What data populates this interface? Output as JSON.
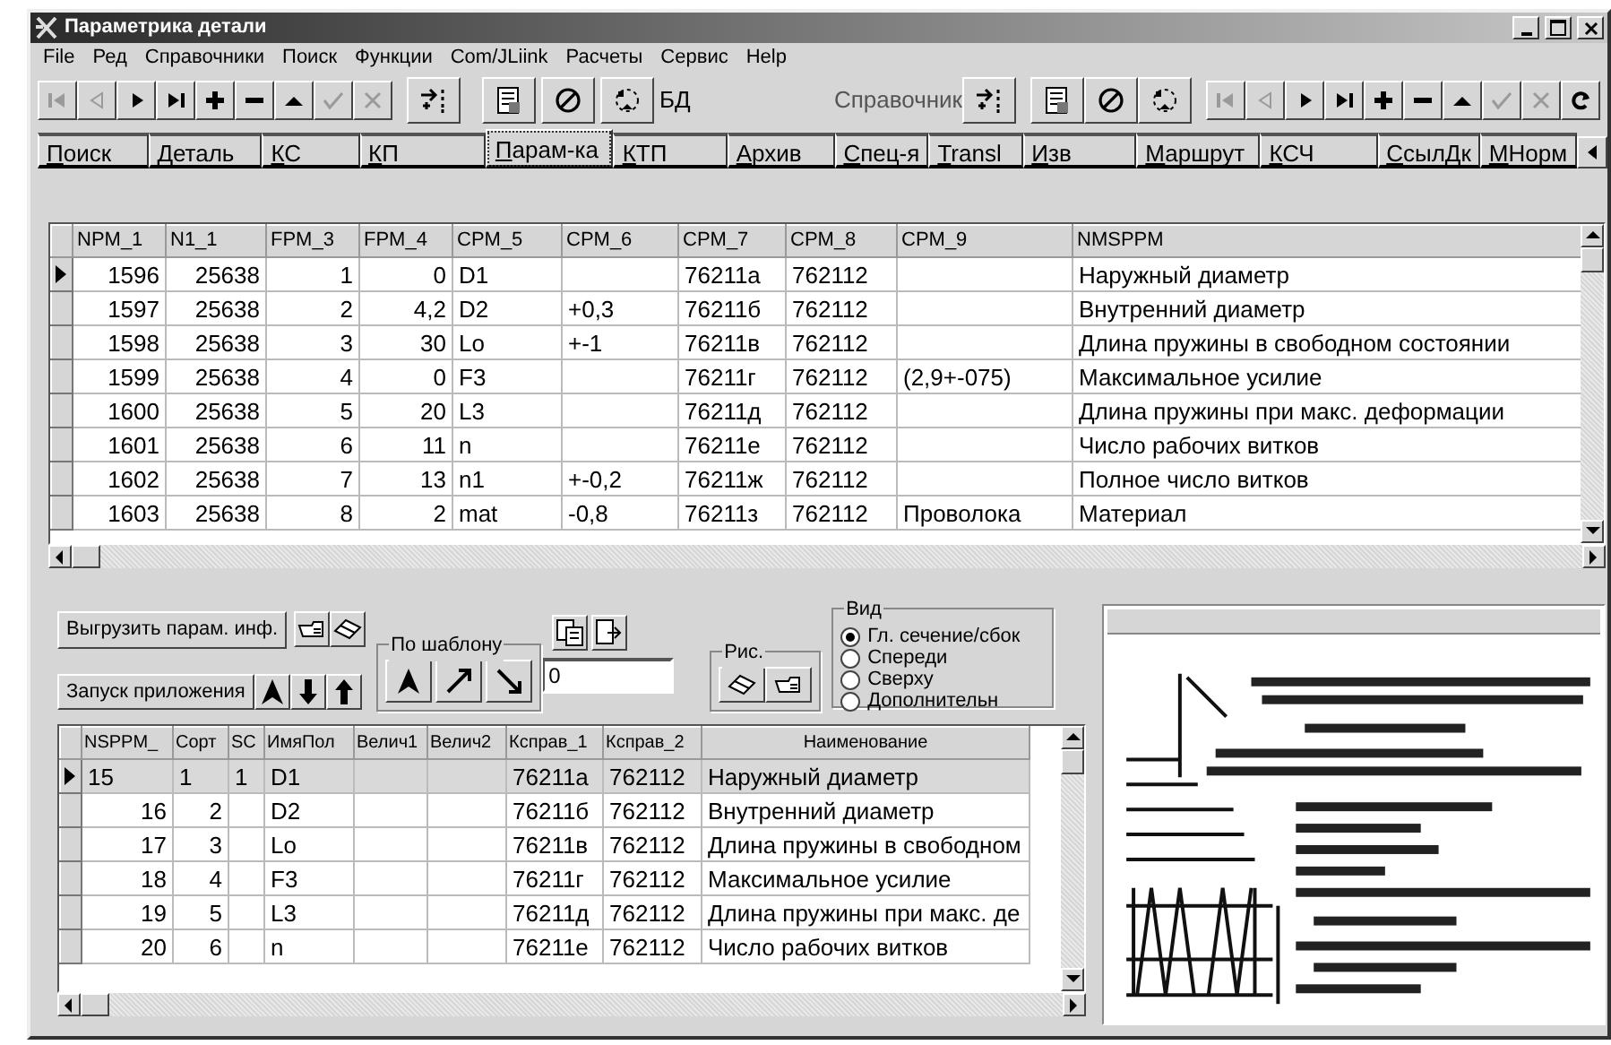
{
  "window": {
    "title": "Параметрика детали"
  },
  "menu": [
    "File",
    "Ред",
    "Справочники",
    "Поиск",
    "Функции",
    "Com/JLiink",
    "Расчеты",
    "Сервис",
    "Help"
  ],
  "toolbar": {
    "left_nav": [
      {
        "kind": "first",
        "disabled": true
      },
      {
        "kind": "prev",
        "disabled": true
      },
      {
        "kind": "next",
        "disabled": false
      },
      {
        "kind": "last",
        "disabled": false
      },
      {
        "kind": "add",
        "disabled": false
      },
      {
        "kind": "delete",
        "disabled": false
      },
      {
        "kind": "post",
        "disabled": false
      },
      {
        "kind": "apply",
        "disabled": true
      },
      {
        "kind": "cancel",
        "disabled": true
      }
    ],
    "db_label": "БД",
    "ref_label": "Справочник",
    "right_nav": [
      {
        "kind": "first",
        "disabled": true
      },
      {
        "kind": "prev",
        "disabled": true
      },
      {
        "kind": "next",
        "disabled": false
      },
      {
        "kind": "last",
        "disabled": false
      },
      {
        "kind": "add",
        "disabled": false
      },
      {
        "kind": "delete",
        "disabled": false
      },
      {
        "kind": "post",
        "disabled": false
      },
      {
        "kind": "apply",
        "disabled": true
      },
      {
        "kind": "cancel",
        "disabled": true
      },
      {
        "kind": "refresh",
        "disabled": false
      }
    ]
  },
  "tabs": [
    {
      "label": "Поиск",
      "selected": false
    },
    {
      "label": "Деталь",
      "selected": false
    },
    {
      "label": "КС",
      "selected": false
    },
    {
      "label": "КП",
      "selected": false
    },
    {
      "label": "Парам-ка",
      "selected": true
    },
    {
      "label": "КТП",
      "selected": false
    },
    {
      "label": "Архив",
      "selected": false
    },
    {
      "label": "Спец-я",
      "selected": false
    },
    {
      "label": "Transl",
      "selected": false
    },
    {
      "label": "Изв",
      "selected": false
    },
    {
      "label": "Маршрут",
      "selected": false
    },
    {
      "label": "КСЧ",
      "selected": false
    },
    {
      "label": "СсылДк",
      "selected": false
    },
    {
      "label": "МНорм",
      "selected": false
    }
  ],
  "parameters_table": {
    "columns": [
      "NPM_1",
      "N1_1",
      "FPM_3",
      "FPM_4",
      "CPM_5",
      "CPM_6",
      "CPM_7",
      "CPM_8",
      "CPM_9",
      "NMSPPM"
    ],
    "rows": [
      {
        "selected": true,
        "cells": [
          "1596",
          "25638",
          "1",
          "0",
          "D1",
          "",
          "76211а",
          "762112",
          "",
          "Наружный диаметр"
        ]
      },
      {
        "selected": false,
        "cells": [
          "1597",
          "25638",
          "2",
          "4,2",
          "D2",
          "+0,3",
          "76211б",
          "762112",
          "",
          "Внутренний диаметр"
        ]
      },
      {
        "selected": false,
        "cells": [
          "1598",
          "25638",
          "3",
          "30",
          "Lo",
          "+-1",
          "76211в",
          "762112",
          "",
          "Длина пружины в свободном состоянии"
        ]
      },
      {
        "selected": false,
        "cells": [
          "1599",
          "25638",
          "4",
          "0",
          "F3",
          "",
          "76211г",
          "762112",
          "(2,9+-075)",
          "Максимальное усилие"
        ]
      },
      {
        "selected": false,
        "cells": [
          "1600",
          "25638",
          "5",
          "20",
          "L3",
          "",
          "76211д",
          "762112",
          "",
          "Длина пружины при макс. деформации"
        ]
      },
      {
        "selected": false,
        "cells": [
          "1601",
          "25638",
          "6",
          "11",
          "n",
          "",
          "76211е",
          "762112",
          "",
          "Число рабочих витков"
        ]
      },
      {
        "selected": false,
        "cells": [
          "1602",
          "25638",
          "7",
          "13",
          "n1",
          "+-0,2",
          "76211ж",
          "762112",
          "",
          "Полное число витков"
        ]
      },
      {
        "selected": false,
        "cells": [
          "1603",
          "25638",
          "8",
          "2",
          "mat",
          "-0,8",
          "76211з",
          "762112",
          "Проволока",
          "Материал"
        ]
      }
    ]
  },
  "controls": {
    "export_button": "Выгрузить парам. инф.",
    "launch_button": "Запуск приложения",
    "template_group": "По шаблону",
    "number_field": "0",
    "figure_group": "Рис.",
    "view_group": {
      "title": "Вид",
      "options": [
        {
          "label": "Гл. сечение/сбок",
          "selected": true
        },
        {
          "label": "Спереди",
          "selected": false
        },
        {
          "label": "Сверху",
          "selected": false
        },
        {
          "label": "Дополнительн",
          "selected": false
        }
      ]
    }
  },
  "fields_table": {
    "columns": [
      "NSPPM_",
      "Сорт",
      "SC",
      "ИмяПол",
      "Велич1",
      "Велич2",
      "Ксправ_1",
      "Ксправ_2",
      "Наименование"
    ],
    "rows": [
      {
        "selected": true,
        "cells": [
          "15",
          "1",
          "1",
          "D1",
          "",
          "",
          "76211а",
          "762112",
          "Наружный диаметр"
        ]
      },
      {
        "selected": false,
        "cells": [
          "16",
          "2",
          "",
          "D2",
          "",
          "",
          "76211б",
          "762112",
          "Внутренний диаметр"
        ]
      },
      {
        "selected": false,
        "cells": [
          "17",
          "3",
          "",
          "Lo",
          "",
          "",
          "76211в",
          "762112",
          "Длина пружины в свободном"
        ]
      },
      {
        "selected": false,
        "cells": [
          "18",
          "4",
          "",
          "F3",
          "",
          "",
          "76211г",
          "762112",
          "Максимальное усилие"
        ]
      },
      {
        "selected": false,
        "cells": [
          "19",
          "5",
          "",
          "L3",
          "",
          "",
          "76211д",
          "762112",
          "Длина пружины при макс. де"
        ]
      },
      {
        "selected": false,
        "cells": [
          "20",
          "6",
          "",
          "n",
          "",
          "",
          "76211е",
          "762112",
          "Число рабочих витков"
        ]
      }
    ]
  }
}
